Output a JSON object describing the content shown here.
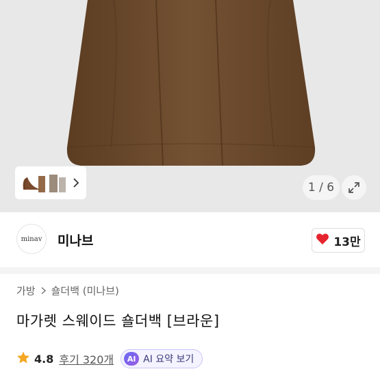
{
  "gallery": {
    "counter": "1 / 6"
  },
  "store": {
    "logo_text": "minav",
    "name": "미나브",
    "likes": "13만"
  },
  "breadcrumb": {
    "category": "가방",
    "subcategory": "숄더백 (미나브)"
  },
  "product": {
    "title": "마가렛 스웨이드 숄더백 [브라운]",
    "rating": "4.8",
    "reviews": "후기 320개",
    "ai_button": "AI 요약 보기",
    "ai_badge": "AI"
  },
  "colors": {
    "bag": "#6b4a2b",
    "heart": "#e5242d",
    "star": "#f5a623",
    "ai_accent": "#6a6bf0"
  },
  "icons": {
    "chevron": "chevron-right-icon",
    "expand": "expand-icon",
    "heart": "heart-icon",
    "star": "star-icon"
  }
}
